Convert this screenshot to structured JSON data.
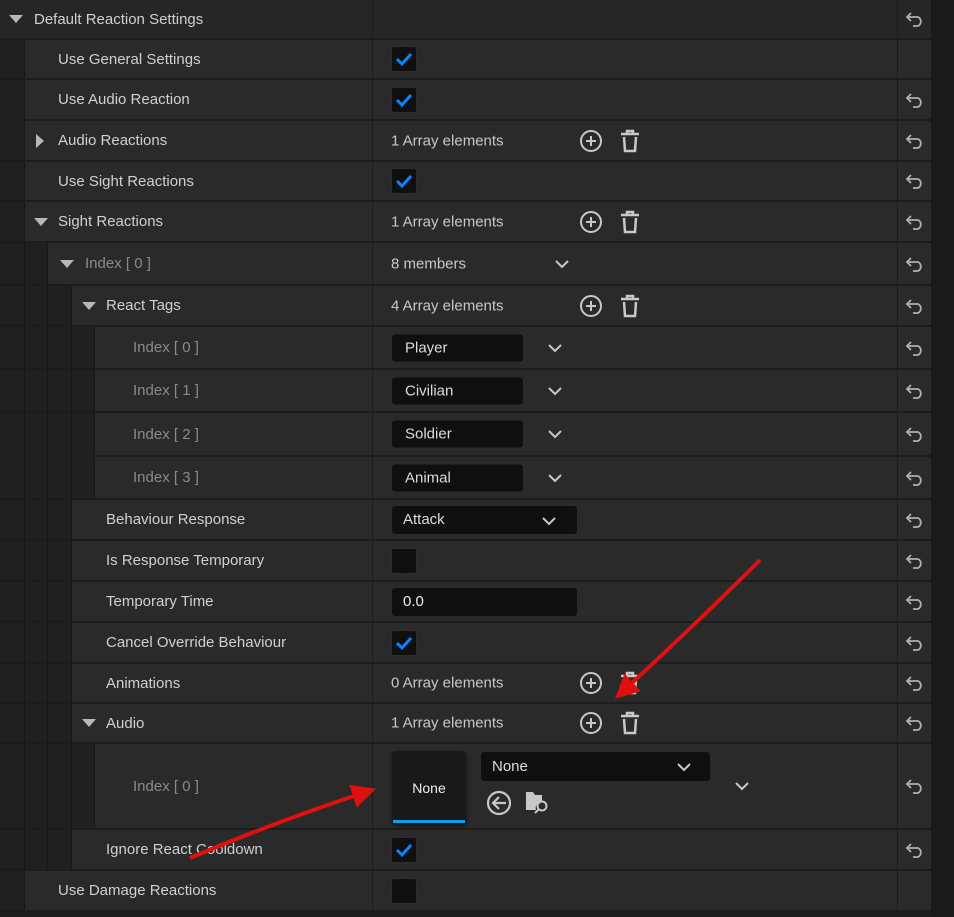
{
  "rows": [
    {
      "label": "Default Reaction Settings",
      "level": 0,
      "arrow": "down",
      "header": true,
      "value": {
        "type": "none"
      },
      "reset": true
    },
    {
      "label": "Use General Settings",
      "level": 1,
      "value": {
        "type": "checkbox",
        "checked": true
      },
      "reset": false
    },
    {
      "label": "Use Audio Reaction",
      "level": 1,
      "value": {
        "type": "checkbox",
        "checked": true
      },
      "reset": true
    },
    {
      "label": "Audio Reactions",
      "level": 1,
      "arrow": "right",
      "value": {
        "type": "array",
        "text": "1 Array elements"
      },
      "reset": true
    },
    {
      "label": "Use Sight Reactions",
      "level": 1,
      "value": {
        "type": "checkbox",
        "checked": true
      },
      "reset": true
    },
    {
      "label": "Sight Reactions",
      "level": 1,
      "arrow": "down",
      "value": {
        "type": "array",
        "text": "1 Array elements"
      },
      "reset": true
    },
    {
      "label": "Index [ 0 ]",
      "level": 2,
      "arrow": "down",
      "dim": true,
      "value": {
        "type": "members",
        "text": "8 members"
      },
      "reset": true
    },
    {
      "label": "React Tags",
      "level": 3,
      "arrow": "down",
      "value": {
        "type": "array",
        "text": "4 Array elements"
      },
      "reset": true
    },
    {
      "label": "Index [ 0 ]",
      "level": 4,
      "dim": true,
      "value": {
        "type": "tag",
        "text": "Player"
      },
      "reset": true
    },
    {
      "label": "Index [ 1 ]",
      "level": 4,
      "dim": true,
      "value": {
        "type": "tag",
        "text": "Civilian"
      },
      "reset": true
    },
    {
      "label": "Index [ 2 ]",
      "level": 4,
      "dim": true,
      "value": {
        "type": "tag",
        "text": "Soldier"
      },
      "reset": true
    },
    {
      "label": "Index [ 3 ]",
      "level": 4,
      "dim": true,
      "value": {
        "type": "tag",
        "text": "Animal"
      },
      "reset": true
    },
    {
      "label": "Behaviour Response",
      "level": 3,
      "value": {
        "type": "enum",
        "text": "Attack"
      },
      "reset": true
    },
    {
      "label": "Is Response Temporary",
      "level": 3,
      "value": {
        "type": "checkbox",
        "checked": false
      },
      "reset": true
    },
    {
      "label": "Temporary Time",
      "level": 3,
      "value": {
        "type": "number",
        "text": "0.0"
      },
      "reset": true
    },
    {
      "label": "Cancel Override Behaviour",
      "level": 3,
      "value": {
        "type": "checkbox",
        "checked": true
      },
      "reset": true
    },
    {
      "label": "Animations",
      "level": 3,
      "value": {
        "type": "array",
        "text": "0 Array elements"
      },
      "reset": true
    },
    {
      "label": "Audio",
      "level": 3,
      "arrow": "down",
      "value": {
        "type": "array",
        "text": "1 Array elements"
      },
      "reset": true
    },
    {
      "label": "Index [ 0 ]",
      "level": 4,
      "dim": true,
      "value": {
        "type": "asset",
        "thumb": "None",
        "selected": "None"
      },
      "reset": true
    },
    {
      "label": "Ignore React Cooldown",
      "level": 3,
      "value": {
        "type": "checkbox",
        "checked": true
      },
      "reset": true
    },
    {
      "label": "Use Damage Reactions",
      "level": 1,
      "value": {
        "type": "checkbox",
        "checked": false
      },
      "reset": false
    }
  ],
  "colors": {
    "accent": "#0a84ff",
    "annotation": "#e01010"
  }
}
